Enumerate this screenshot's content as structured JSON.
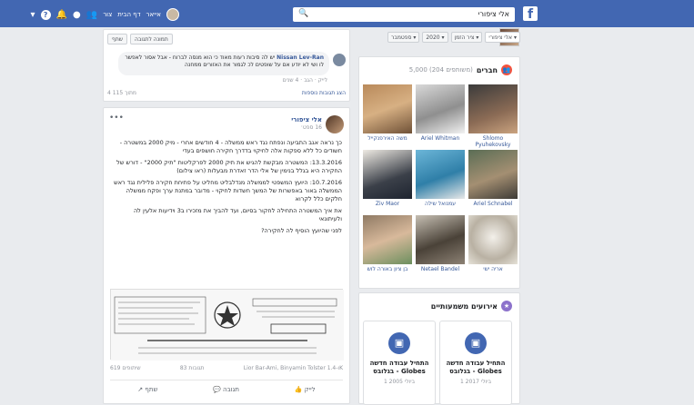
{
  "topbar": {
    "search_query": "אלי ציפורי",
    "nav_name": "אייאר",
    "nav_home": "דף הבית",
    "nav_create": "צור"
  },
  "filters": {
    "name": "אלי ציפורי",
    "member": "ציר הזמן",
    "year": "2020",
    "month": "ספטמבר"
  },
  "friends": {
    "title": "חברים",
    "count": "5,000 (204 משותפים)",
    "items": [
      {
        "name": "Shlomo Pyuhekovsky"
      },
      {
        "name": "Ariel Whitman"
      },
      {
        "name": "משה האירפנקייל"
      },
      {
        "name": "Ariel Schnabel"
      },
      {
        "name": "עמנואל שילה"
      },
      {
        "name": "Ziv Maor"
      },
      {
        "name": "אריה ישי"
      },
      {
        "name": "Netael Bandel"
      },
      {
        "name": "בן ציון באורה לוש"
      }
    ]
  },
  "events": {
    "title": "אירועים משמעותיים",
    "items": [
      {
        "title": "התחיל עבודה חדשה בגלובס - Globes",
        "date": "1 ביולי 2017"
      },
      {
        "title": "התחיל עבודה חדשה בגלובס - Globes",
        "date": "1 ביולי 2005"
      }
    ]
  },
  "post1": {
    "tab_share": "שתף",
    "tab_tag": "תמונה לתגובה",
    "comment_author": "Nissan Lev-Ran",
    "comment_text": "יש לה סיבות רעות מאוד כי הוא מנסה לברוח - אבל אסור לאפשר לו ושי לא יודע אם על שופטים לכ לגמור את האזורים ממחנה",
    "comment_meta": "לייק · הגב · 4 שנים",
    "more_comments": "הצג תגובות נוספות",
    "count": "4 מתוך 115"
  },
  "post2": {
    "author": "אלי ציפורי",
    "date": "16 ספט׳",
    "more": "•••",
    "paragraphs": [
      "כך נראה אגב התביעה ונפתח נגד ראש ממשלה - 4 חודשים אחרי - מיק 2000 במשטרה - חשודים כל ללא ספקות אלה לחיקוי בדדרך חקירה חושפים בעדי",
      "13.3.2016: המשטרה מבקשת להגיש את תיק 2000 לפרקליטות \"תיק 2000\" - דורש של החקירה היא בגלל בנימין של אלי הדר זאדרת מבעלות (ראו צילום)",
      "10.7.2016: היועץ המשפטי לממשלה מנדלבליט מחליט על פתיחת חקירה פלילית נגד ראש הממשלה באור באפשרות של המשך חשדות לחיקוי - מדובר במתנת ערך ופקח ממשלה חלקים כלל לקרוא",
      "את איך המשטרה התחילה לחקור בסיום, ועד להביך את מזכירו ב3 וידיעות אלעין לה ולעיתונאי",
      "לפני שהיועץ הוסיף לה לחקירה?"
    ],
    "reaction_names": "Lior Bar-Ami, Binyamin Tolster ו-1.4K",
    "comment_count": "83 תגובות",
    "share_count": "619 שיתופים",
    "like": "לייק",
    "comment": "תגובה",
    "share": "שתף"
  },
  "colors": {
    "brand": "#4267b2",
    "link": "#365899",
    "background": "#e9ebee"
  }
}
